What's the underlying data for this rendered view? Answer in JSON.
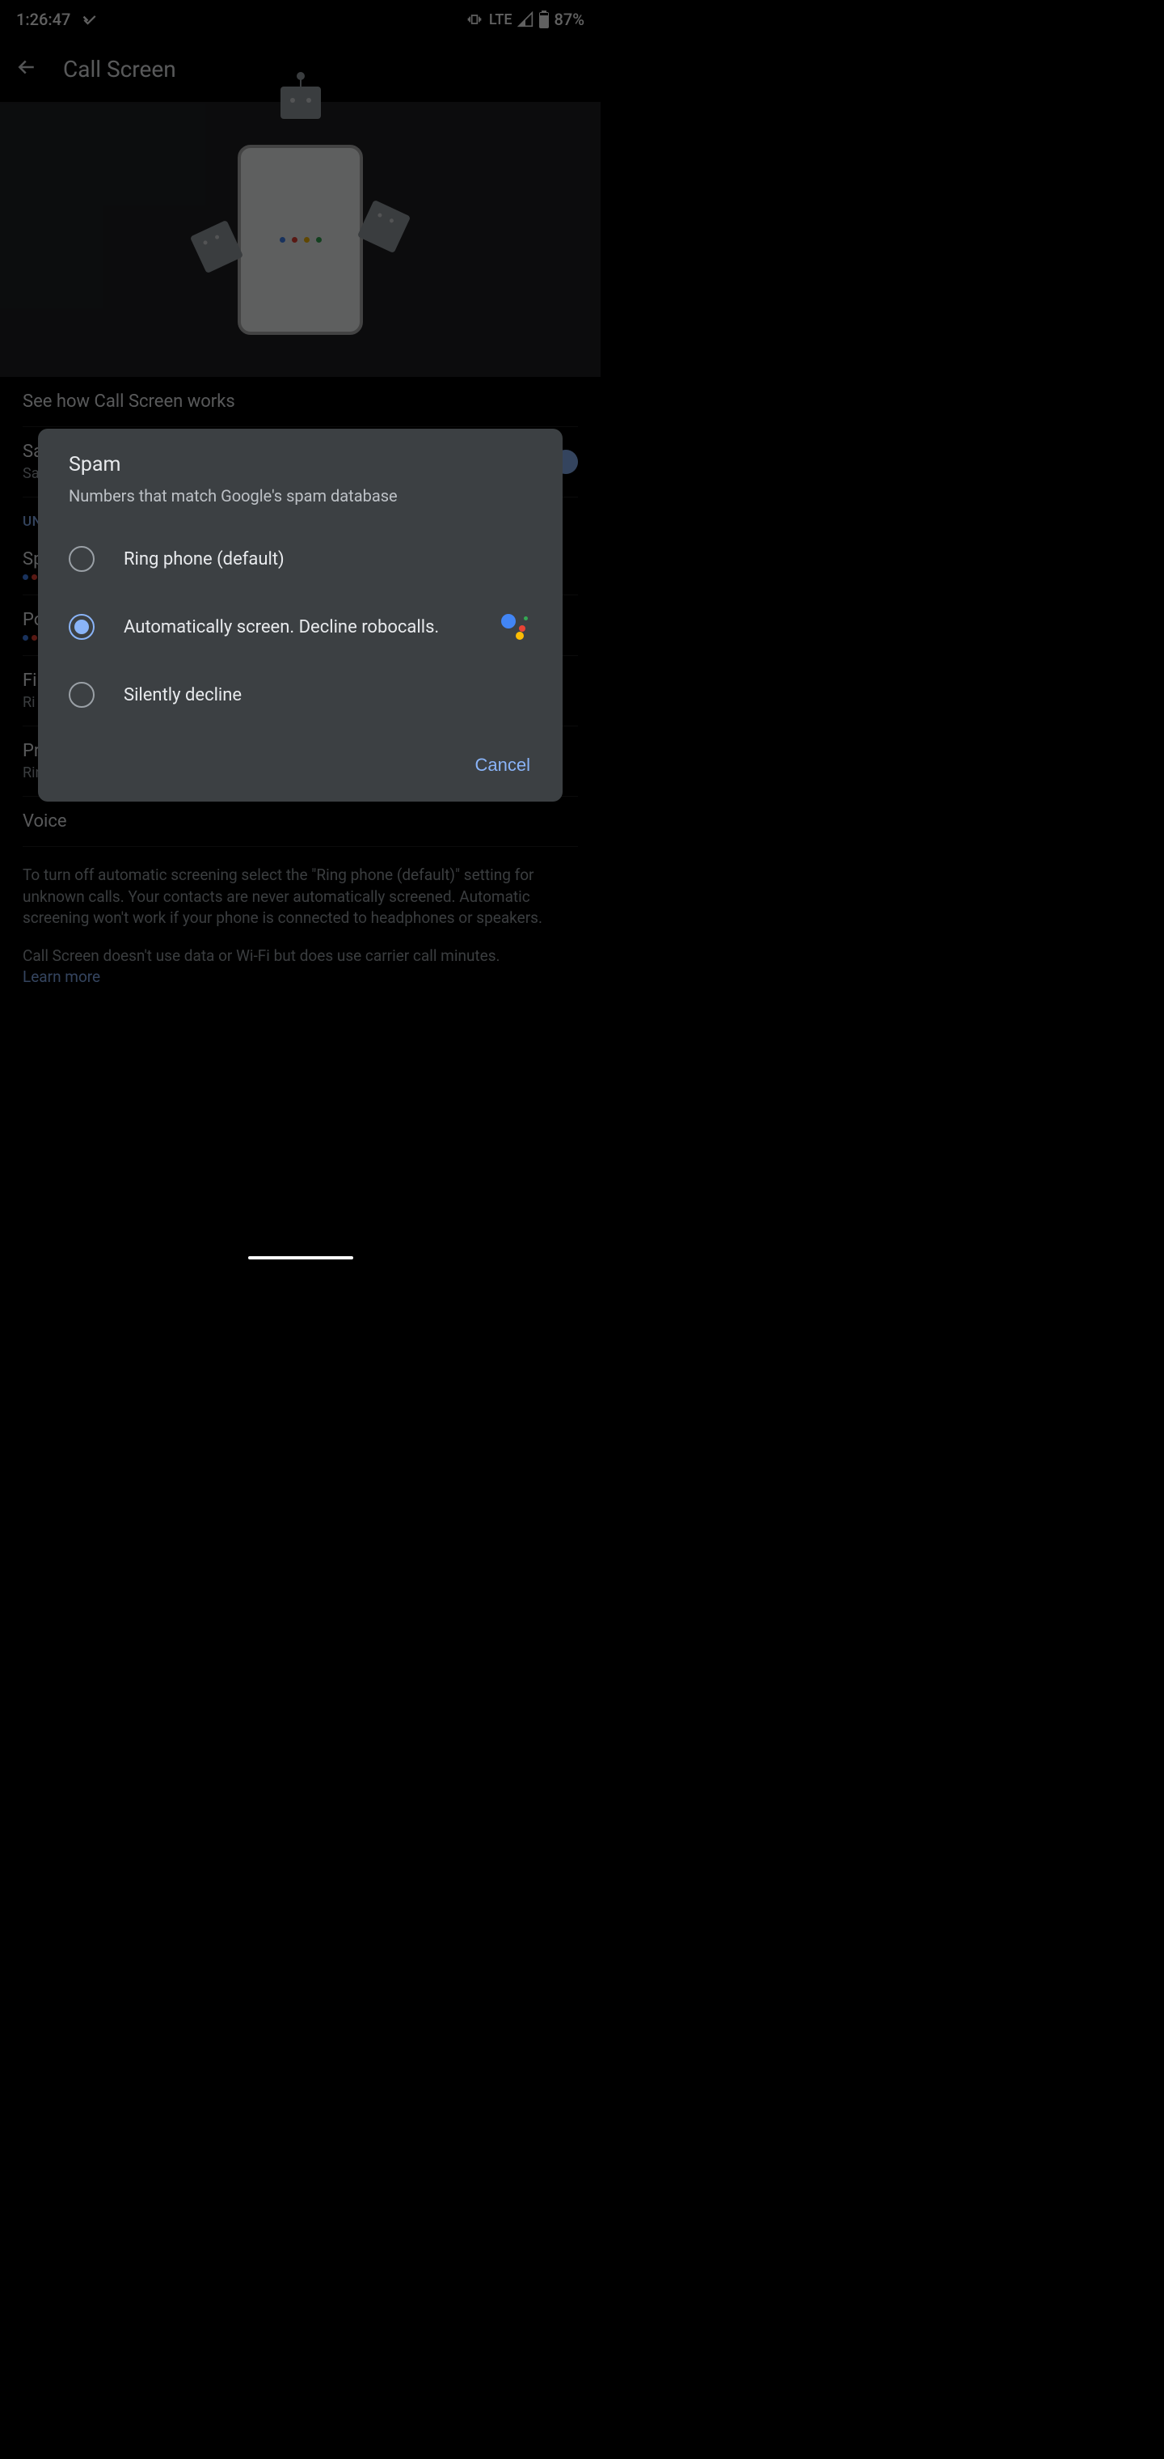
{
  "status": {
    "time": "1:26:47",
    "network": "LTE",
    "battery": "87%"
  },
  "header": {
    "title": "Call Screen"
  },
  "rows": {
    "how_it_works": "See how Call Screen works",
    "save_title": "Sa",
    "save_sub": "Sa",
    "section": "UN",
    "spam_title": "Sp",
    "po_title": "Po",
    "fi_title": "Fi",
    "fi_sub": "Ri",
    "private_title": "Private or hidden",
    "private_sub": "Ring phone (default)",
    "voice_title": "Voice"
  },
  "info1": "To turn off automatic screening select the \"Ring phone (default)\" setting for unknown calls. Your contacts are never automatically screened. Automatic screening won't work if your phone is connected to headphones or speakers.",
  "info2": "Call Screen doesn't use data or Wi-Fi but does use carrier call minutes.",
  "learn_more": "Learn more",
  "dialog": {
    "title": "Spam",
    "desc": "Numbers that match Google's spam database",
    "options": [
      "Ring phone (default)",
      "Automatically screen. Decline robocalls.",
      "Silently decline"
    ],
    "selected": 1,
    "cancel": "Cancel"
  }
}
